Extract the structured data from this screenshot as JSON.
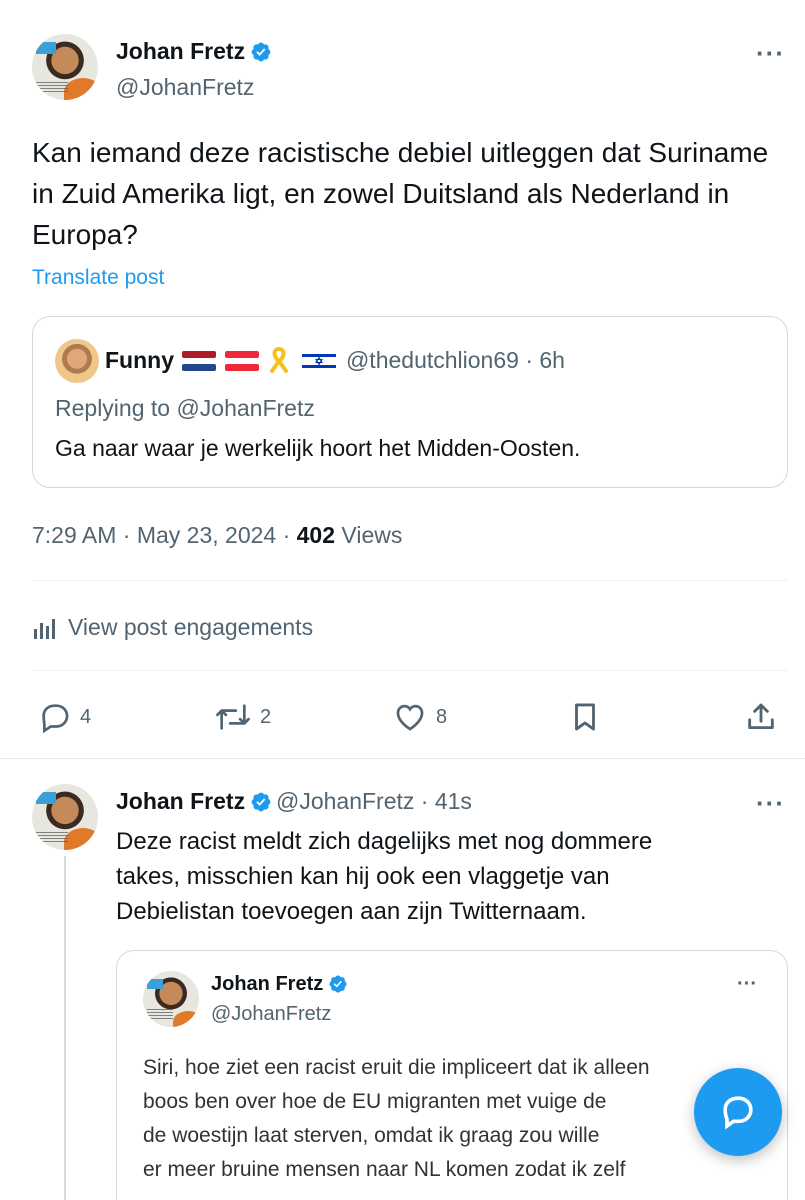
{
  "main_post": {
    "author_name": "Johan Fretz",
    "handle": "@JohanFretz",
    "text": "Kan iemand deze racistische debiel uitleggen dat Suriname in Zuid Amerika ligt, en zowel Duitsland als Nederland in Europa?",
    "translate": "Translate post",
    "quote": {
      "author_name": "Funny",
      "handle_time": "@thedutchlion69 · 6h",
      "replying": "Replying to @JohanFretz",
      "text": "Ga naar waar je werkelijk hoort het Midden-Oosten."
    },
    "timestamp": "7:29 AM · May 23, 2024 · ",
    "views_count": "402",
    "views_label": " Views",
    "engagements": "View post engagements",
    "actions": {
      "replies": "4",
      "reposts": "2",
      "likes": "8"
    }
  },
  "reply_post": {
    "author_name": "Johan Fretz",
    "handle_time": "@JohanFretz · 41s",
    "text": "Deze racist meldt zich dagelijks met nog dommere takes, misschien kan hij ook een vlaggetje van Debielistan toevoegen aan zijn Twitternaam.",
    "embedded": {
      "author_name": "Johan Fretz",
      "handle": "@JohanFretz",
      "text_lines": [
        "Siri, hoe ziet een racist eruit die impliceert dat ik alleen",
        "boos ben over hoe de EU migranten met vuige de",
        "de woestijn laat sterven, omdat ik graag zou wille",
        "er meer bruine mensen naar NL komen zodat ik zelf"
      ]
    }
  },
  "colors": {
    "accent": "#1d9bf0",
    "secondary_text": "#536471",
    "border": "#cfd9de"
  },
  "icons": [
    "verified-badge-icon",
    "more-icon",
    "reply-icon",
    "repost-icon",
    "like-icon",
    "bookmark-icon",
    "share-icon",
    "analytics-icon",
    "ribbon-icon",
    "compose-icon"
  ]
}
